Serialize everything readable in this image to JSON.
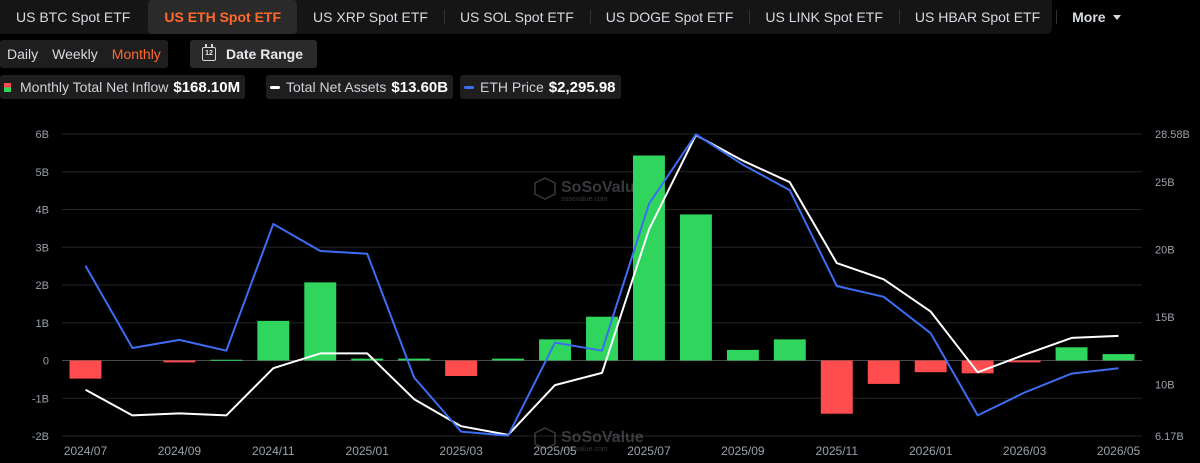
{
  "tabs": [
    {
      "label": "US BTC Spot ETF"
    },
    {
      "label": "US ETH Spot ETF"
    },
    {
      "label": "US XRP Spot ETF"
    },
    {
      "label": "US SOL Spot ETF"
    },
    {
      "label": "US DOGE Spot ETF"
    },
    {
      "label": "US LINK Spot ETF"
    },
    {
      "label": "US HBAR Spot ETF"
    },
    {
      "label": "More"
    }
  ],
  "periods": [
    {
      "label": "Daily"
    },
    {
      "label": "Weekly"
    },
    {
      "label": "Monthly"
    }
  ],
  "date_range_label": "Date Range",
  "calendar_day": "12",
  "legend": {
    "inflow": {
      "label": "Monthly Total Net Inflow",
      "value": "$168.10M"
    },
    "assets": {
      "label": "Total Net Assets",
      "value": "$13.60B",
      "color": "#ffffff"
    },
    "price": {
      "label": "ETH Price",
      "value": "$2,295.98",
      "color": "#3d6df2"
    }
  },
  "watermark": {
    "brand": "SoSoValue",
    "url": "sosovalue.com"
  },
  "colors": {
    "positive": "#2fd55c",
    "negative": "#ff4d4f",
    "active_tab": "#ff6a2b"
  },
  "chart_data": {
    "type": "bar",
    "x": [
      "2024/07",
      "2024/08",
      "2024/09",
      "2024/10",
      "2024/11",
      "2024/12",
      "2025/01",
      "2025/02",
      "2025/03",
      "2025/04",
      "2025/05",
      "2025/06",
      "2025/07",
      "2025/08",
      "2025/09",
      "2025/10",
      "2025/11",
      "2025/12",
      "2026/01",
      "2026/02",
      "2026/03",
      "2026/04",
      "2026/05"
    ],
    "x_tick_labels": [
      "2024/07",
      "2024/09",
      "2024/11",
      "2025/01",
      "2025/03",
      "2025/05",
      "2025/07",
      "2025/09",
      "2025/11",
      "2026/01",
      "2026/03",
      "2026/05"
    ],
    "left_axis": {
      "ylim": [
        -2,
        6
      ],
      "ticks": [
        -2,
        -1,
        0,
        1,
        2,
        3,
        4,
        5,
        6
      ],
      "tick_labels": [
        "-2B",
        "-1B",
        "0",
        "1B",
        "2B",
        "3B",
        "4B",
        "5B",
        "6B"
      ]
    },
    "right_axis": {
      "ylim": [
        6.17,
        28.58
      ],
      "ticks": [
        6.17,
        10,
        15,
        20,
        25,
        28.58
      ],
      "tick_labels": [
        "6.17B",
        "10B",
        "15B",
        "20B",
        "25B",
        "28.58B"
      ]
    },
    "series": [
      {
        "name": "Monthly Total Net Inflow",
        "type": "bar",
        "axis": "left",
        "values": [
          -0.48,
          0.0,
          -0.05,
          0.02,
          1.05,
          2.07,
          0.05,
          0.05,
          -0.41,
          0.05,
          0.56,
          1.16,
          5.43,
          3.87,
          0.28,
          0.56,
          -1.41,
          -0.62,
          -0.31,
          -0.34,
          -0.05,
          0.35,
          0.17
        ]
      },
      {
        "name": "Total Net Assets",
        "type": "line",
        "axis": "right",
        "values": [
          9.6,
          7.7,
          7.85,
          7.7,
          11.2,
          12.3,
          12.3,
          8.9,
          6.9,
          6.25,
          9.95,
          10.85,
          21.5,
          28.5,
          26.6,
          25.0,
          19.0,
          17.8,
          15.4,
          10.9,
          12.2,
          13.45,
          13.6
        ]
      },
      {
        "name": "ETH Price",
        "type": "line",
        "axis": "right",
        "values": [
          18.8,
          12.7,
          13.3,
          12.5,
          21.9,
          19.9,
          19.7,
          10.5,
          6.5,
          6.2,
          13.1,
          12.5,
          23.4,
          28.55,
          26.3,
          24.4,
          17.3,
          16.5,
          13.8,
          7.7,
          9.4,
          10.8,
          11.2
        ]
      }
    ]
  }
}
